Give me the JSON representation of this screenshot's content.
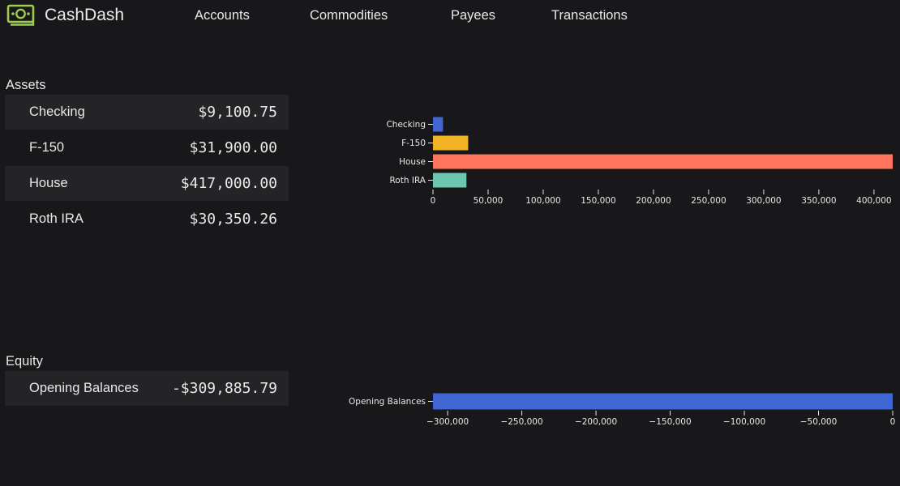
{
  "app": {
    "title": "CashDash",
    "logo_icon": "cash-icon",
    "accent": "#9ccd4e"
  },
  "nav": {
    "items": [
      "Accounts",
      "Commodities",
      "Payees",
      "Transactions"
    ]
  },
  "assets": {
    "title": "Assets",
    "rows": [
      {
        "name": "Checking",
        "amount": "$9,100.75"
      },
      {
        "name": "F-150",
        "amount": "$31,900.00"
      },
      {
        "name": "House",
        "amount": "$417,000.00"
      },
      {
        "name": "Roth IRA",
        "amount": "$30,350.26"
      }
    ]
  },
  "equity": {
    "title": "Equity",
    "rows": [
      {
        "name": "Opening Balances",
        "amount": "-$309,885.79"
      }
    ]
  },
  "chart_data": [
    {
      "type": "bar",
      "orientation": "horizontal",
      "categories": [
        "Checking",
        "F-150",
        "House",
        "Roth IRA"
      ],
      "values": [
        9100.75,
        31900.0,
        417000.0,
        30350.26
      ],
      "colors": [
        "#4066d4",
        "#f0b323",
        "#fe745c",
        "#6ec6b1"
      ],
      "xlim": [
        0,
        417000
      ],
      "xticks": [
        0,
        50000,
        100000,
        150000,
        200000,
        250000,
        300000,
        350000,
        400000
      ],
      "xtick_labels": [
        "0",
        "50,000",
        "100,000",
        "150,000",
        "200,000",
        "250,000",
        "300,000",
        "350,000",
        "400,000"
      ]
    },
    {
      "type": "bar",
      "orientation": "horizontal",
      "categories": [
        "Opening Balances"
      ],
      "values": [
        -309885.79
      ],
      "colors": [
        "#4066d4"
      ],
      "xlim": [
        -309885.79,
        0
      ],
      "xticks": [
        -300000,
        -250000,
        -200000,
        -150000,
        -100000,
        -50000,
        0
      ],
      "xtick_labels": [
        "−300,000",
        "−250,000",
        "−200,000",
        "−150,000",
        "−100,000",
        "−50,000",
        "0"
      ]
    }
  ]
}
